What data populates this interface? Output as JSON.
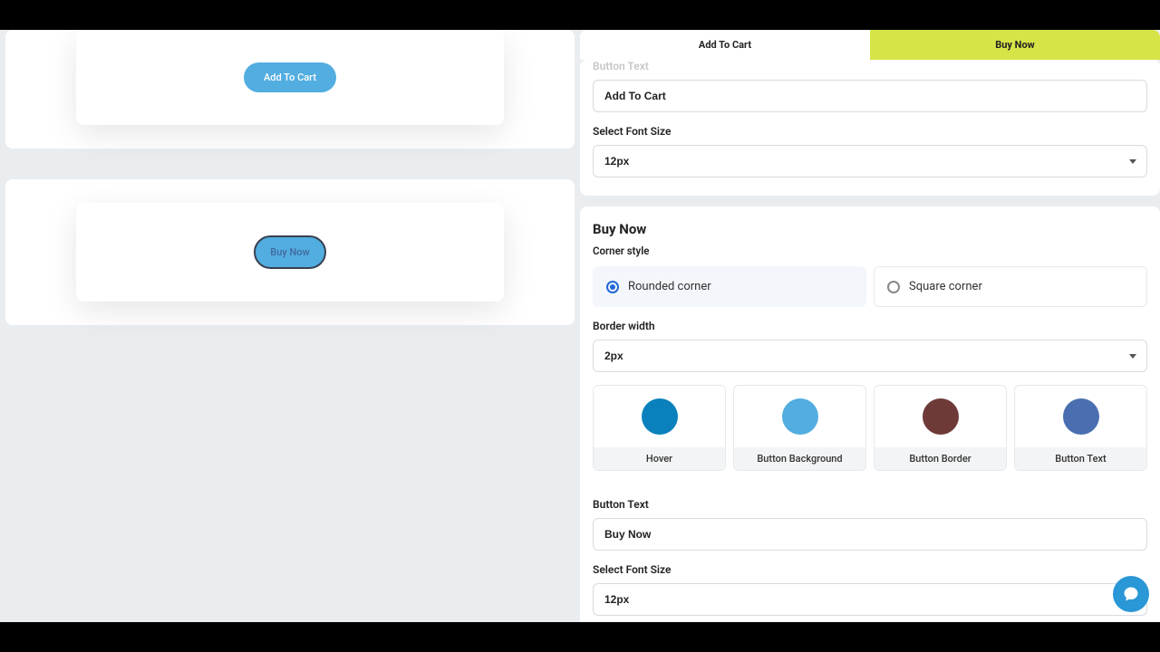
{
  "tabs": {
    "add": "Add To Cart",
    "buy": "Buy Now"
  },
  "preview": {
    "add_label": "Add To Cart",
    "buy_label": "Buy Now"
  },
  "addToCart": {
    "button_text_label_truncated": "Button Text",
    "button_text_value": "Add To Cart",
    "select_font_size_label": "Select Font Size",
    "font_size_value": "12px"
  },
  "buyNow": {
    "title": "Buy Now",
    "corner_style_label": "Corner style",
    "corner_rounded": "Rounded corner",
    "corner_square": "Square corner",
    "border_width_label": "Border width",
    "border_width_value": "2px",
    "swatches": {
      "hover": {
        "label": "Hover",
        "color": "#0a81bd"
      },
      "background": {
        "label": "Button Background",
        "color": "#52ade0"
      },
      "border": {
        "label": "Button Border",
        "color": "#6e3a38"
      },
      "text": {
        "label": "Button Text",
        "color": "#4a6fb0"
      }
    },
    "button_text_label": "Button Text",
    "button_text_value": "Buy Now",
    "select_font_size_label": "Select Font Size",
    "font_size_value": "12px"
  }
}
